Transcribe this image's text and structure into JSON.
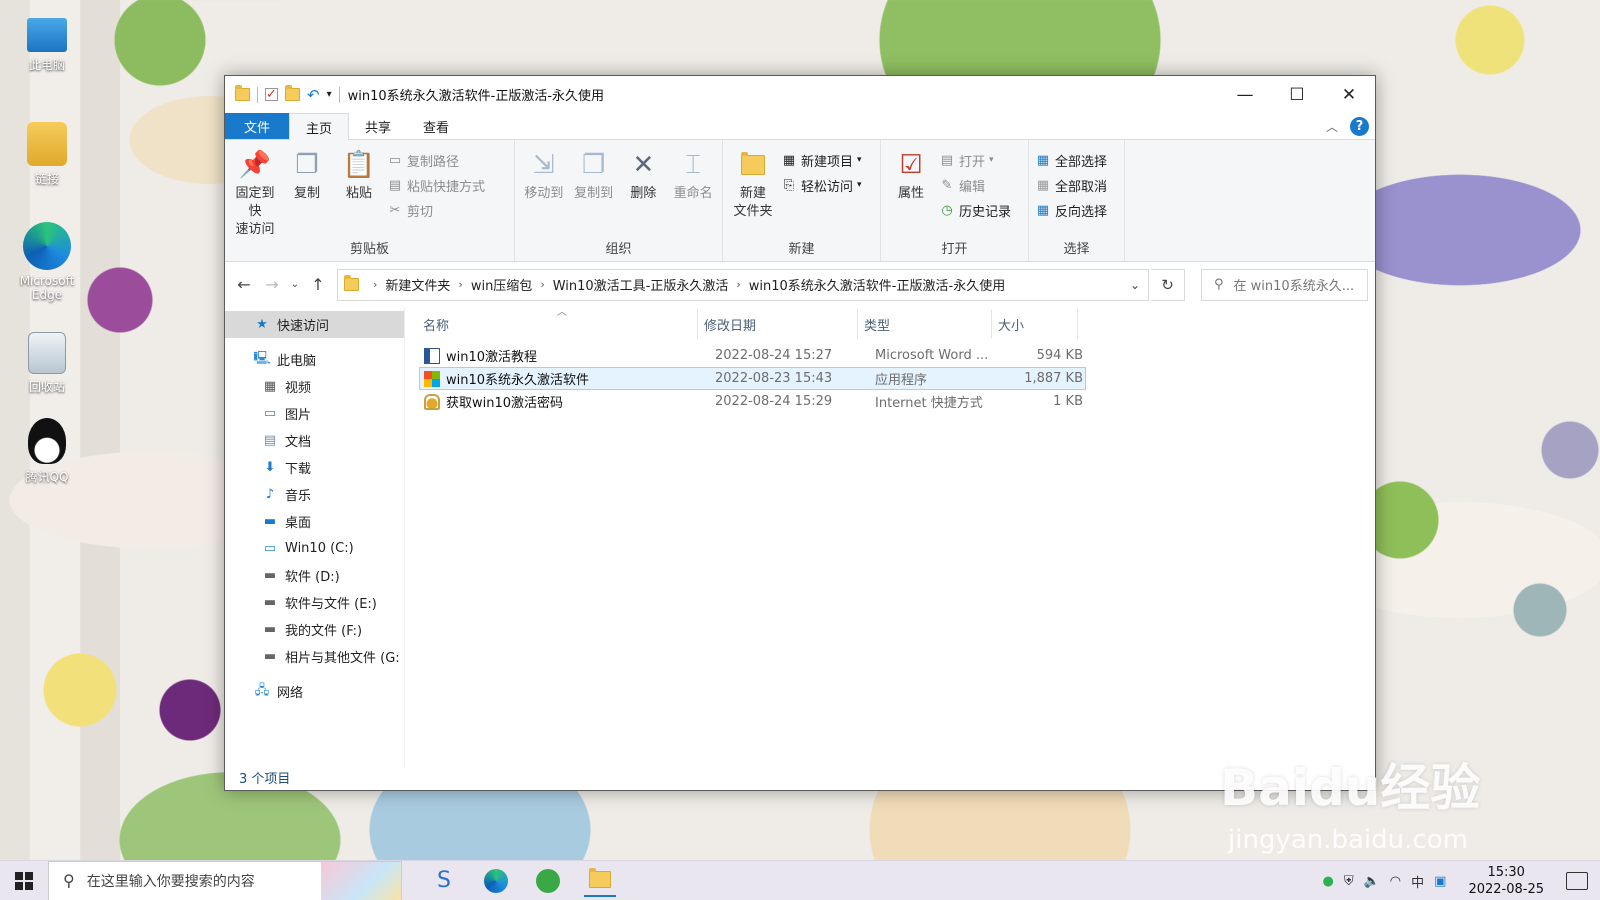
{
  "desktop": {
    "icons": [
      {
        "label": "此电脑"
      },
      {
        "label": "链接"
      },
      {
        "label": "Microsoft Edge"
      },
      {
        "label": "回收站"
      },
      {
        "label": "腾讯QQ"
      }
    ]
  },
  "window": {
    "title": "win10系统永久激活软件-正版激活-永久使用",
    "tabs": {
      "file": "文件",
      "home": "主页",
      "share": "共享",
      "view": "查看"
    },
    "ribbon": {
      "clipboard": {
        "pin": "固定到快速访问",
        "pin_l1": "固定到快",
        "pin_l2": "速访问",
        "copy": "复制",
        "paste": "粘贴",
        "copy_path": "复制路径",
        "paste_shortcut": "粘贴快捷方式",
        "cut": "剪切",
        "label": "剪贴板"
      },
      "organize": {
        "move_to": "移动到",
        "copy_to": "复制到",
        "delete": "删除",
        "rename": "重命名",
        "label": "组织"
      },
      "new": {
        "new_folder_l1": "新建",
        "new_folder_l2": "文件夹",
        "new_item": "新建项目",
        "easy_access": "轻松访问",
        "label": "新建"
      },
      "open": {
        "properties": "属性",
        "open": "打开",
        "edit": "编辑",
        "history": "历史记录",
        "label": "打开"
      },
      "select": {
        "select_all": "全部选择",
        "select_none": "全部取消",
        "invert": "反向选择",
        "label": "选择"
      }
    },
    "address": {
      "crumbs": [
        "新建文件夹",
        "win压缩包",
        "Win10激活工具-正版永久激活",
        "win10系统永久激活软件-正版激活-永久使用"
      ],
      "search_placeholder": "在 win10系统永久..."
    },
    "nav": {
      "quick_access": "快速访问",
      "this_pc": "此电脑",
      "videos": "视频",
      "pictures": "图片",
      "documents": "文档",
      "downloads": "下载",
      "music": "音乐",
      "desktop": "桌面",
      "drive_c": "Win10 (C:)",
      "drive_d": "软件 (D:)",
      "drive_e": "软件与文件 (E:)",
      "drive_f": "我的文件 (F:)",
      "drive_g": "相片与其他文件 (G:",
      "network": "网络"
    },
    "columns": {
      "name": "名称",
      "date": "修改日期",
      "type": "类型",
      "size": "大小"
    },
    "files": [
      {
        "name": "win10激活教程",
        "date": "2022-08-24 15:27",
        "type": "Microsoft Word ...",
        "size": "594 KB"
      },
      {
        "name": "win10系统永久激活软件",
        "date": "2022-08-23 15:43",
        "type": "应用程序",
        "size": "1,887 KB"
      },
      {
        "name": "获取win10激活密码",
        "date": "2022-08-24 15:29",
        "type": "Internet 快捷方式",
        "size": "1 KB"
      }
    ],
    "status": "3 个项目"
  },
  "taskbar": {
    "search_placeholder": "在这里输入你要搜索的内容",
    "time": "15:30",
    "date": "2022-08-25"
  },
  "watermark": {
    "line1": "Baidu经验",
    "line2": "jingyan.baidu.com"
  },
  "colors": {
    "accent": "#1979ca",
    "selection": "#e5f3ff",
    "selection_border": "#99d1ff"
  }
}
